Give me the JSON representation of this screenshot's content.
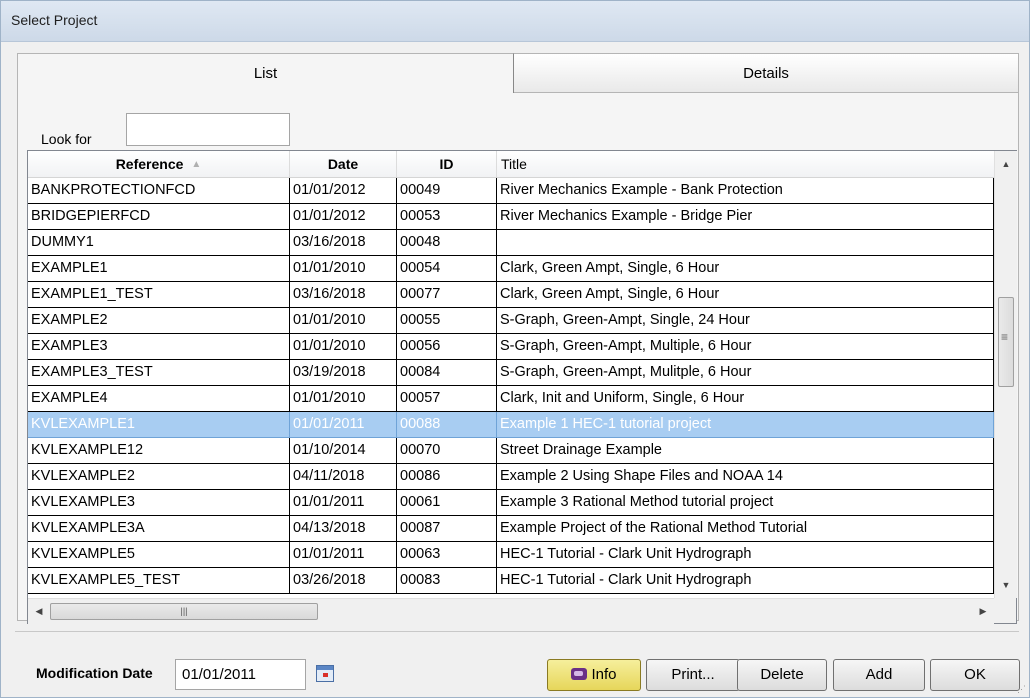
{
  "window": {
    "title": "Select Project"
  },
  "tabs": [
    {
      "label": "List",
      "active": true
    },
    {
      "label": "Details",
      "active": false
    }
  ],
  "search": {
    "label": "Look for",
    "value": ""
  },
  "table": {
    "columns": [
      "Reference",
      "Date",
      "ID",
      "Title"
    ],
    "sort": {
      "column": "Reference",
      "direction": "ascending"
    },
    "rows": [
      {
        "reference": "BANKPROTECTIONFCD",
        "date": "01/01/2012",
        "id": "00049",
        "title": "River Mechanics Example - Bank Protection"
      },
      {
        "reference": "BRIDGEPIERFCD",
        "date": "01/01/2012",
        "id": "00053",
        "title": "River Mechanics Example - Bridge Pier"
      },
      {
        "reference": "DUMMY1",
        "date": "03/16/2018",
        "id": "00048",
        "title": ""
      },
      {
        "reference": "EXAMPLE1",
        "date": "01/01/2010",
        "id": "00054",
        "title": "Clark, Green Ampt, Single, 6 Hour"
      },
      {
        "reference": "EXAMPLE1_TEST",
        "date": "03/16/2018",
        "id": "00077",
        "title": "Clark, Green Ampt, Single, 6 Hour"
      },
      {
        "reference": "EXAMPLE2",
        "date": "01/01/2010",
        "id": "00055",
        "title": "S-Graph, Green-Ampt, Single, 24 Hour"
      },
      {
        "reference": "EXAMPLE3",
        "date": "01/01/2010",
        "id": "00056",
        "title": "S-Graph, Green-Ampt, Multiple, 6 Hour"
      },
      {
        "reference": "EXAMPLE3_TEST",
        "date": "03/19/2018",
        "id": "00084",
        "title": "S-Graph, Green-Ampt, Mulitple, 6 Hour"
      },
      {
        "reference": "EXAMPLE4",
        "date": "01/01/2010",
        "id": "00057",
        "title": "Clark, Init and Uniform, Single, 6 Hour"
      },
      {
        "reference": "KVLEXAMPLE1",
        "date": "01/01/2011",
        "id": "00088",
        "title": "Example 1 HEC-1 tutorial project",
        "selected": true
      },
      {
        "reference": "KVLEXAMPLE12",
        "date": "01/10/2014",
        "id": "00070",
        "title": "Street Drainage Example"
      },
      {
        "reference": "KVLEXAMPLE2",
        "date": "04/11/2018",
        "id": "00086",
        "title": "Example 2 Using Shape Files and NOAA 14"
      },
      {
        "reference": "KVLEXAMPLE3",
        "date": "01/01/2011",
        "id": "00061",
        "title": "Example 3 Rational Method tutorial project"
      },
      {
        "reference": "KVLEXAMPLE3A",
        "date": "04/13/2018",
        "id": "00087",
        "title": "Example Project of the Rational Method Tutorial"
      },
      {
        "reference": "KVLEXAMPLE5",
        "date": "01/01/2011",
        "id": "00063",
        "title": "HEC-1 Tutorial - Clark Unit Hydrograph"
      },
      {
        "reference": "KVLEXAMPLE5_TEST",
        "date": "03/26/2018",
        "id": "00083",
        "title": "HEC-1 Tutorial - Clark Unit Hydrograph"
      }
    ]
  },
  "footer": {
    "mod_date_label": "Modification Date",
    "mod_date_value": "01/01/2011",
    "buttons": {
      "info": "Info",
      "print": "Print...",
      "delete": "Delete",
      "add": "Add",
      "ok": "OK"
    }
  },
  "colors": {
    "selection": "#a8cdf2",
    "info_button": "#e6d65a",
    "titlebar": "#cdd9e8"
  },
  "icons": [
    "sort-ascending-icon",
    "calendar-icon",
    "info-book-icon",
    "scroll-up-icon",
    "scroll-down-icon",
    "scroll-left-icon",
    "scroll-right-icon",
    "resize-grip-icon"
  ]
}
